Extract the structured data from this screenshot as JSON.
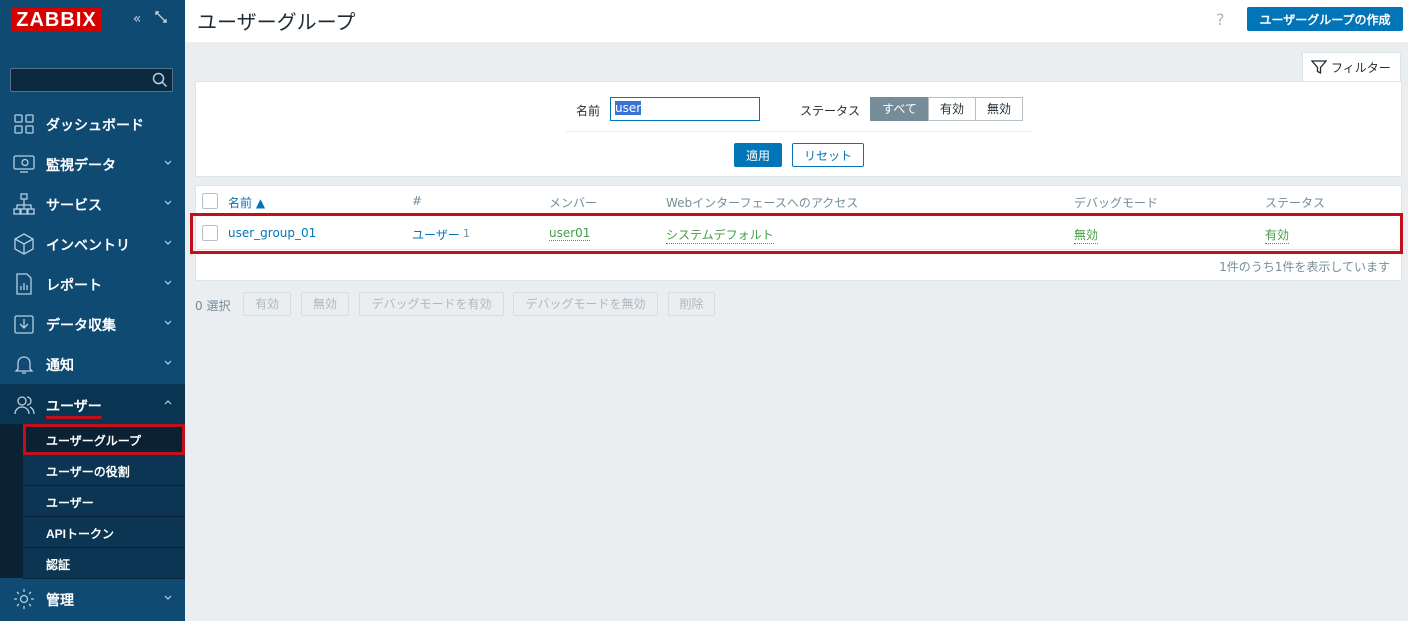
{
  "sidebar": {
    "logo": "ZABBIX",
    "search_placeholder": "",
    "items": [
      {
        "label": "ダッシュボード",
        "icon": "dashboard-icon",
        "has_chevron": false
      },
      {
        "label": "監視データ",
        "icon": "monitoring-icon",
        "has_chevron": true
      },
      {
        "label": "サービス",
        "icon": "services-icon",
        "has_chevron": true
      },
      {
        "label": "インベントリ",
        "icon": "inventory-icon",
        "has_chevron": true
      },
      {
        "label": "レポート",
        "icon": "reports-icon",
        "has_chevron": true
      },
      {
        "label": "データ収集",
        "icon": "data-collection-icon",
        "has_chevron": true
      },
      {
        "label": "通知",
        "icon": "bell-icon",
        "has_chevron": true
      },
      {
        "label": "ユーザー",
        "icon": "users-icon",
        "has_chevron": true
      },
      {
        "label": "管理",
        "icon": "gear-icon",
        "has_chevron": true
      }
    ],
    "submenu": [
      "ユーザーグループ",
      "ユーザーの役割",
      "ユーザー",
      "APIトークン",
      "認証"
    ]
  },
  "header": {
    "title": "ユーザーグループ",
    "help": "?",
    "create_button": "ユーザーグループの作成"
  },
  "filter": {
    "tab_label": "フィルター",
    "name_label": "名前",
    "name_value": "user",
    "status_label": "ステータス",
    "status_options": [
      "すべて",
      "有効",
      "無効"
    ],
    "status_selected": "すべて",
    "apply": "適用",
    "reset": "リセット"
  },
  "table": {
    "columns": {
      "name": "名前 ▲",
      "count": "#",
      "members": "メンバー",
      "web_access": "Webインターフェースへのアクセス",
      "debug": "デバッグモード",
      "status": "ステータス"
    },
    "rows": [
      {
        "name": "user_group_01",
        "users_link": "ユーザー",
        "users_count": "1",
        "members": "user01",
        "web_access": "システムデフォルト",
        "debug": "無効",
        "status": "有効"
      }
    ],
    "footer": "1件のうち1件を表示しています"
  },
  "actions": {
    "selected": "0 選択",
    "buttons": [
      "有効",
      "無効",
      "デバッグモードを有効",
      "デバッグモードを無効",
      "削除"
    ]
  },
  "colors": {
    "sidebar_bg": "#0e4a72",
    "accent": "#0275b8",
    "highlight": "#c0101a",
    "green": "#429e47"
  }
}
